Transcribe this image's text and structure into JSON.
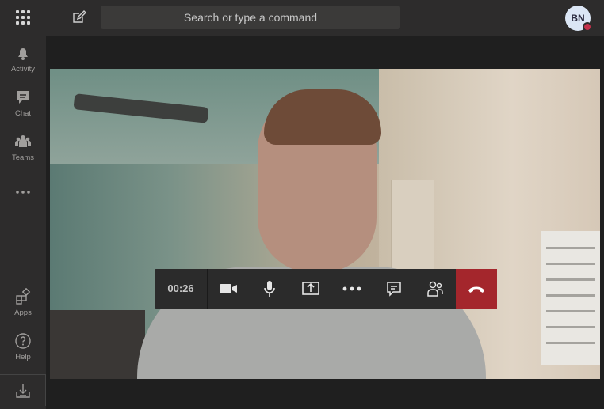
{
  "topbar": {
    "search_placeholder": "Search or type a command",
    "avatar_initials": "BN",
    "presence_color": "#c4314b"
  },
  "rail": {
    "items": [
      {
        "label": "Activity",
        "icon": "bell-icon"
      },
      {
        "label": "Chat",
        "icon": "chat-icon"
      },
      {
        "label": "Teams",
        "icon": "teams-icon"
      },
      {
        "label": "",
        "icon": "more-icon"
      },
      {
        "label": "Apps",
        "icon": "apps-icon"
      },
      {
        "label": "Help",
        "icon": "help-icon"
      }
    ],
    "download_icon": "download-icon"
  },
  "call": {
    "timer": "00:26",
    "controls": [
      "camera-icon",
      "microphone-icon",
      "share-screen-icon",
      "more-options-icon",
      "chat-icon",
      "participants-icon",
      "hang-up-icon"
    ],
    "hangup_color": "#a4262c"
  }
}
